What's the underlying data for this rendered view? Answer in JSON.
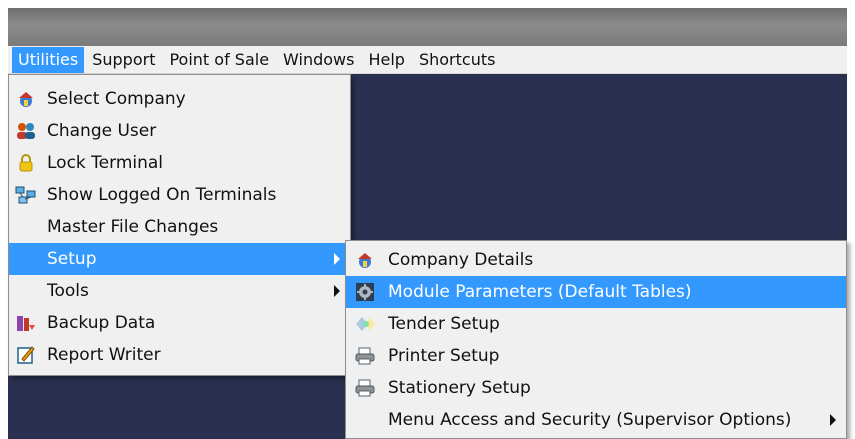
{
  "menubar": {
    "items": [
      {
        "label": "Utilities",
        "active": true
      },
      {
        "label": "Support"
      },
      {
        "label": "Point of Sale"
      },
      {
        "label": "Windows"
      },
      {
        "label": "Help"
      },
      {
        "label": "Shortcuts"
      }
    ]
  },
  "utilities_menu": {
    "items": [
      {
        "label": "Select Company",
        "icon": "house-globe-icon"
      },
      {
        "label": "Change User",
        "icon": "users-icon"
      },
      {
        "label": "Lock Terminal",
        "icon": "padlock-icon"
      },
      {
        "label": "Show Logged On Terminals",
        "icon": "network-computers-icon"
      },
      {
        "label": "Master File Changes",
        "icon": ""
      },
      {
        "label": "Setup",
        "icon": "",
        "highlighted": true,
        "submenu": true
      },
      {
        "label": "Tools",
        "icon": "",
        "submenu": true
      },
      {
        "label": "Backup Data",
        "icon": "backup-icon"
      },
      {
        "label": "Report Writer",
        "icon": "report-writer-icon"
      }
    ]
  },
  "setup_menu": {
    "items": [
      {
        "label": "Company Details",
        "icon": "house-globe-icon"
      },
      {
        "label": "Module Parameters (Default Tables)",
        "icon": "gear-icon",
        "highlighted": true
      },
      {
        "label": "Tender Setup",
        "icon": "tender-icon"
      },
      {
        "label": "Printer Setup",
        "icon": "printer-icon"
      },
      {
        "label": "Stationery Setup",
        "icon": "printer-icon"
      },
      {
        "label": "Menu Access and Security (Supervisor Options)",
        "icon": "",
        "submenu": true
      }
    ]
  },
  "colors": {
    "highlight": "#3399ff",
    "workspace": "#2a3150",
    "menu_bg": "#f0f0f0"
  }
}
